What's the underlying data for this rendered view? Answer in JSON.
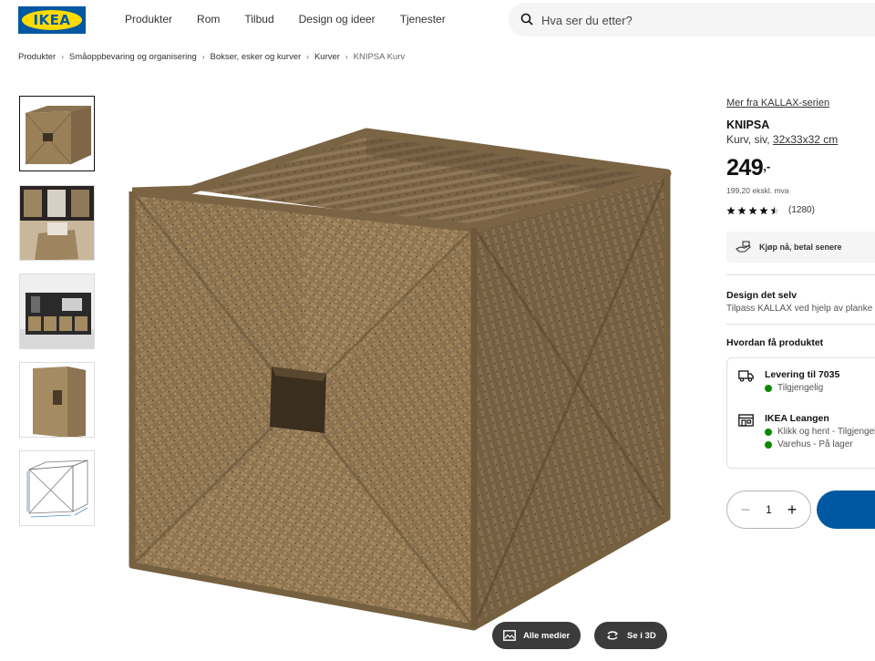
{
  "header": {
    "logo_text": "IKEA",
    "nav": [
      "Produkter",
      "Rom",
      "Tilbud",
      "Design og ideer",
      "Tjenester"
    ],
    "search_placeholder": "Hva ser du etter?"
  },
  "breadcrumb": [
    "Produkter",
    "Småoppbevaring og organisering",
    "Bokser, esker og kurver",
    "Kurver",
    "KNIPSA Kurv"
  ],
  "media_buttons": {
    "all_media": "Alle medier",
    "view_3d": "Se i 3D"
  },
  "product": {
    "series_link": "Mer fra KALLAX-serien",
    "name": "KNIPSA",
    "description": "Kurv, siv,",
    "size": "32x33x32 cm",
    "price": "249",
    "price_suffix": ",-",
    "price_ex_vat": "199,20 ekskl. mva",
    "rating_value": 4.5,
    "rating_count": "(1280)",
    "klarna_text": "Kjøp nå, betal senere"
  },
  "design": {
    "title": "Design det selv",
    "subtitle": "Tilpass KALLAX ved hjelp av planke"
  },
  "availability": {
    "title": "Hvordan få produktet",
    "delivery_title": "Levering til 7035",
    "delivery_status": "Tilgjengelig",
    "store_title": "IKEA Leangen",
    "store_click_collect": "Klikk og hent - Tilgjengelig",
    "store_warehouse": "Varehus - På lager",
    "status_color": "#0a8a00"
  },
  "cart": {
    "quantity": "1",
    "minus": "−",
    "plus": "+"
  },
  "colors": {
    "brand_blue": "#0058a3",
    "brand_yellow": "#ffdb00"
  }
}
